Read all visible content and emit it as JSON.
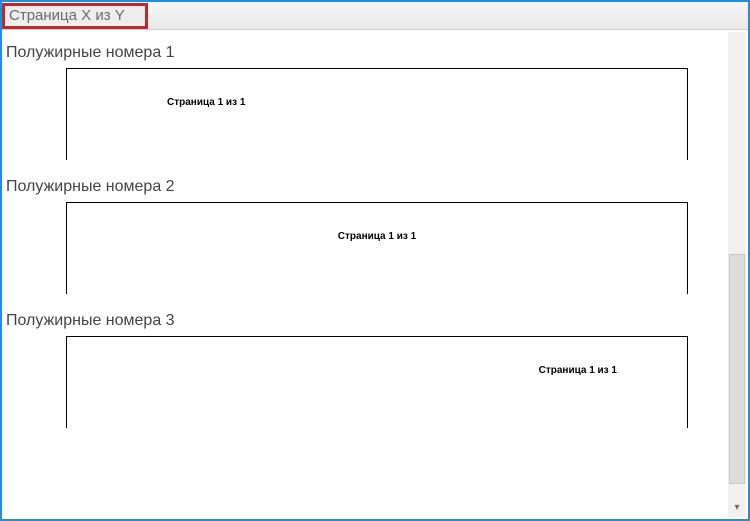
{
  "header": {
    "section_title": "Страница X из Y"
  },
  "entries": [
    {
      "title": "Полужирные номера 1",
      "page_text": "Страница 1 из 1",
      "align": "left"
    },
    {
      "title": "Полужирные номера 2",
      "page_text": "Страница 1 из 1",
      "align": "center"
    },
    {
      "title": "Полужирные номера 3",
      "page_text": "Страница 1 из 1",
      "align": "right"
    }
  ]
}
